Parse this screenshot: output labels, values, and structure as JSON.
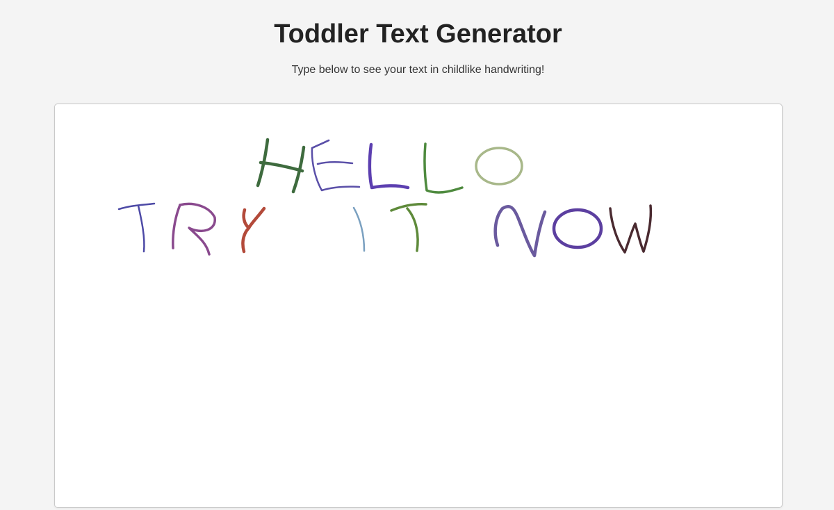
{
  "header": {
    "title": "Toddler Text Generator",
    "subtitle": "Type below to see your text in childlike handwriting!"
  },
  "editor": {
    "lines": [
      "HELLO",
      "TRY IT NOW"
    ]
  },
  "colors": {
    "page_background": "#f4f4f4",
    "canvas_background": "#ffffff",
    "letters": {
      "H": "#3e6b3e",
      "E": "#5a4fa8",
      "L1": "#5c3fb0",
      "L2": "#4e8a3e",
      "O1": "#a8b88a",
      "T1": "#4d4aa6",
      "R": "#8a4a8e",
      "Y": "#b34a3a",
      "I": "#7aa0c0",
      "T2": "#5e8a3a",
      "N": "#6a5a9e",
      "O2": "#5c3fa0",
      "W": "#4a2a30"
    }
  }
}
